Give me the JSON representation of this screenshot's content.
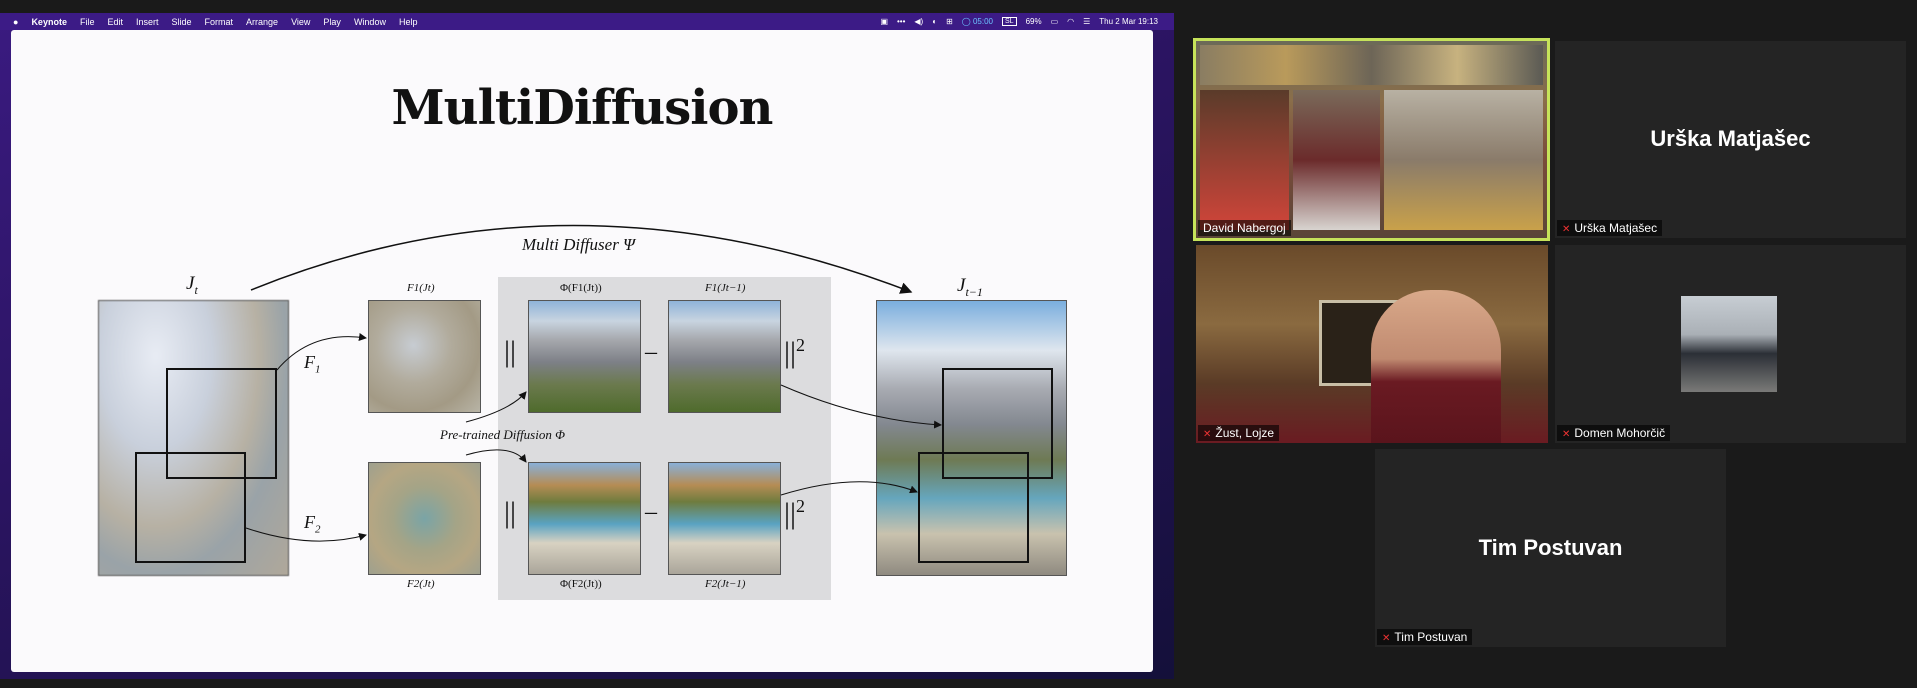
{
  "menubar": {
    "app_name": "Keynote",
    "items": [
      "File",
      "Edit",
      "Insert",
      "Slide",
      "Format",
      "Arrange",
      "View",
      "Play",
      "Window",
      "Help"
    ],
    "timer": "05:00",
    "keyboard": "SL",
    "battery": "69%",
    "datetime": "Thu 2 Mar  19:13"
  },
  "slide": {
    "title": "MultiDiffusion",
    "multi_label": "Multi Diffuser Ψ",
    "pretrained_label": "Pre-trained Diffusion Φ",
    "jt": "J",
    "jt_sub": "t",
    "jt1": "J",
    "jt1_sub": "t−1",
    "f1": "F",
    "f1_sub": "1",
    "f2": "F",
    "f2_sub": "2",
    "label_f1jt": "F1(Jt)",
    "label_f2jt": "F2(Jt)",
    "label_phi1": "Φ(F1(Jt))",
    "label_phi2": "Φ(F2(Jt))",
    "label_f1jt1": "F1(Jt−1)",
    "label_f2jt1": "F2(Jt−1)",
    "norm_open": "||",
    "norm_close": "||",
    "sq": "2",
    "minus": "–"
  },
  "participants": [
    {
      "name": "David Nabergoj",
      "type": "video",
      "active": true
    },
    {
      "name": "Urška Matjašec",
      "type": "name-only",
      "muted": true
    },
    {
      "name": "Žust, Lojze",
      "type": "video",
      "muted": true
    },
    {
      "name": "Domen Mohorčič",
      "type": "photo",
      "muted": true
    },
    {
      "name": "Tim Postuvan",
      "type": "name-only",
      "muted": true
    }
  ],
  "colors": {
    "menubar": "#3c1b86",
    "active_speaker_border": "#c6e35a",
    "mute_icon": "#e33333",
    "tile_bg": "#242424"
  }
}
